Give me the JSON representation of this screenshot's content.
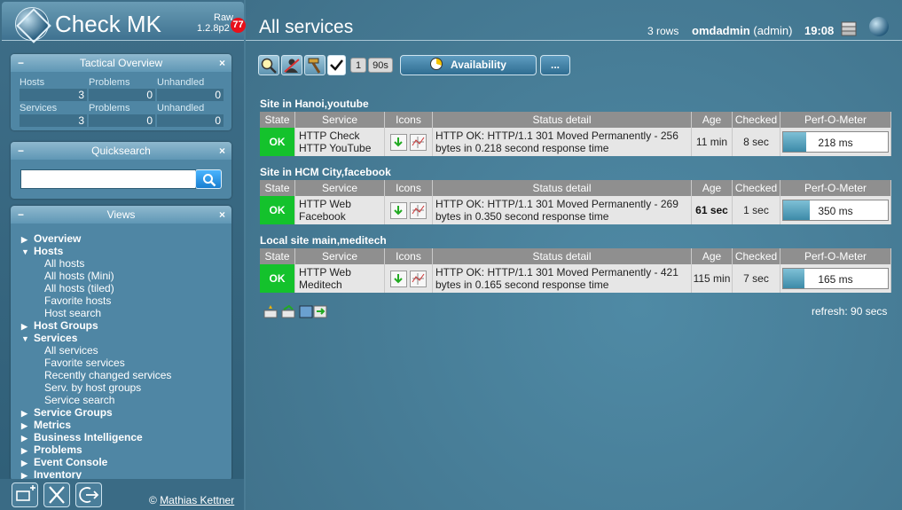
{
  "sidebar": {
    "brand": "Check MK",
    "edition": "Raw",
    "version": "1.2.8p2",
    "notification_count": "77",
    "tactical": {
      "title": "Tactical Overview",
      "rows": [
        {
          "label": "Hosts",
          "total": "3",
          "problems_label": "Problems",
          "problems": "0",
          "unhandled_label": "Unhandled",
          "unhandled": "0"
        },
        {
          "label": "Services",
          "total": "3",
          "problems_label": "Problems",
          "problems": "0",
          "unhandled_label": "Unhandled",
          "unhandled": "0"
        }
      ]
    },
    "quicksearch": {
      "title": "Quicksearch",
      "value": ""
    },
    "views": {
      "title": "Views",
      "items": [
        {
          "type": "cat",
          "label": "Overview",
          "open": false
        },
        {
          "type": "cat",
          "label": "Hosts",
          "open": true
        },
        {
          "type": "item",
          "label": "All hosts"
        },
        {
          "type": "item",
          "label": "All hosts (Mini)"
        },
        {
          "type": "item",
          "label": "All hosts (tiled)"
        },
        {
          "type": "item",
          "label": "Favorite hosts"
        },
        {
          "type": "item",
          "label": "Host search"
        },
        {
          "type": "cat",
          "label": "Host Groups",
          "open": false
        },
        {
          "type": "cat",
          "label": "Services",
          "open": true
        },
        {
          "type": "item",
          "label": "All services"
        },
        {
          "type": "item",
          "label": "Favorite services"
        },
        {
          "type": "item",
          "label": "Recently changed services"
        },
        {
          "type": "item",
          "label": "Serv. by host groups"
        },
        {
          "type": "item",
          "label": "Service search"
        },
        {
          "type": "cat",
          "label": "Service Groups",
          "open": false
        },
        {
          "type": "cat",
          "label": "Metrics",
          "open": false
        },
        {
          "type": "cat",
          "label": "Business Intelligence",
          "open": false
        },
        {
          "type": "cat",
          "label": "Problems",
          "open": false
        },
        {
          "type": "cat",
          "label": "Event Console",
          "open": false
        },
        {
          "type": "cat",
          "label": "Inventory",
          "open": false
        }
      ]
    },
    "footer": {
      "copyright_symbol": "©",
      "copyright_name": "Mathias Kettner"
    }
  },
  "header": {
    "title": "All services",
    "rows": "3 rows",
    "user": "omdadmin",
    "role": "(admin)",
    "time": "19:08"
  },
  "toolbar": {
    "refresh_count": "1",
    "refresh_interval": "90s",
    "availability_label": "Availability",
    "more_label": "..."
  },
  "columns": [
    "State",
    "Service",
    "Icons",
    "Status detail",
    "Age",
    "Checked",
    "Perf-O-Meter"
  ],
  "groups": [
    {
      "title": "Site in Hanoi,youtube",
      "rows": [
        {
          "state": "OK",
          "service": "HTTP Check HTTP YouTube",
          "detail": "HTTP OK: HTTP/1.1 301 Moved Permanently - 256 bytes in 0.218 second response time",
          "age": "11 min",
          "checked": "8 sec",
          "perf": "218 ms",
          "perf_fraction": 0.22
        }
      ]
    },
    {
      "title": "Site in HCM City,facebook",
      "rows": [
        {
          "state": "OK",
          "service": "HTTP Web Facebook",
          "detail": "HTTP OK: HTTP/1.1 301 Moved Permanently - 269 bytes in 0.350 second response time",
          "age": "61 sec",
          "checked": "1 sec",
          "perf": "350 ms",
          "perf_fraction": 0.25
        }
      ]
    },
    {
      "title": "Local site main,meditech",
      "rows": [
        {
          "state": "OK",
          "service": "HTTP Web Meditech",
          "detail": "HTTP OK: HTTP/1.1 301 Moved Permanently - 421 bytes in 0.165 second response time",
          "age": "115 min",
          "checked": "7 sec",
          "perf": "165 ms",
          "perf_fraction": 0.2
        }
      ]
    }
  ],
  "refresh_text": "refresh: 90 secs",
  "colors": {
    "ok": "#14c22c",
    "badge": "#e8101a",
    "header_gray": "#8f8f8f"
  }
}
